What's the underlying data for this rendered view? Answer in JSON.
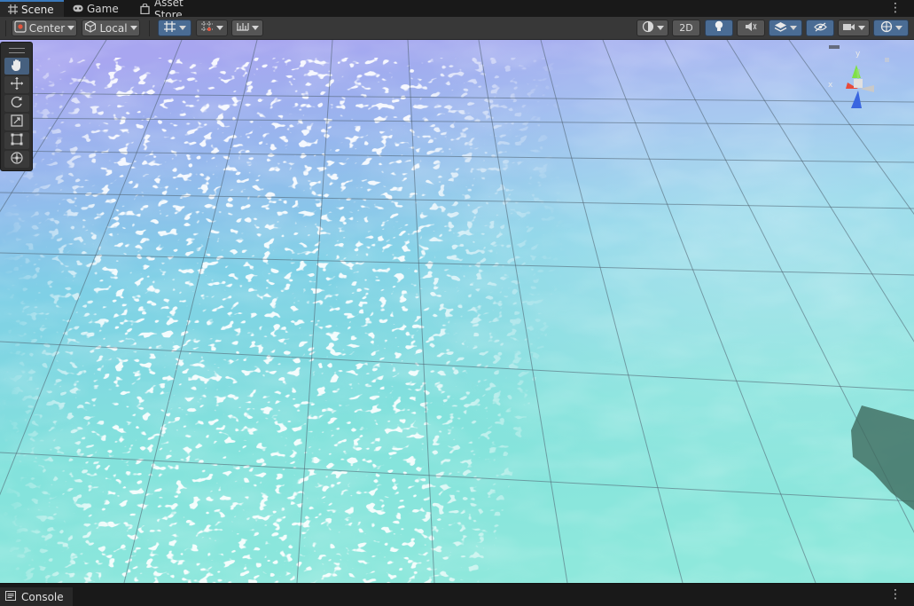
{
  "tabs": [
    {
      "label": "Scene",
      "icon": "grid-icon",
      "active": true
    },
    {
      "label": "Game",
      "icon": "gamepad-icon",
      "active": false
    },
    {
      "label": "Asset Store",
      "icon": "shopping-bag-icon",
      "active": false
    }
  ],
  "toolbar": {
    "pivot_label": "Center",
    "space_label": "Local",
    "mode_2d_label": "2D"
  },
  "tools": [
    "hand-tool",
    "move-tool",
    "rotate-tool",
    "scale-tool",
    "rect-tool",
    "transform-tool"
  ],
  "gizmo": {
    "x_label": "x",
    "y_label": "y"
  },
  "console": {
    "label": "Console"
  },
  "colors": {
    "accent": "#3a79bb",
    "toolbar_bg": "#383838",
    "water_top": "#a7a9ee",
    "water_bottom": "#7fe3d8"
  }
}
